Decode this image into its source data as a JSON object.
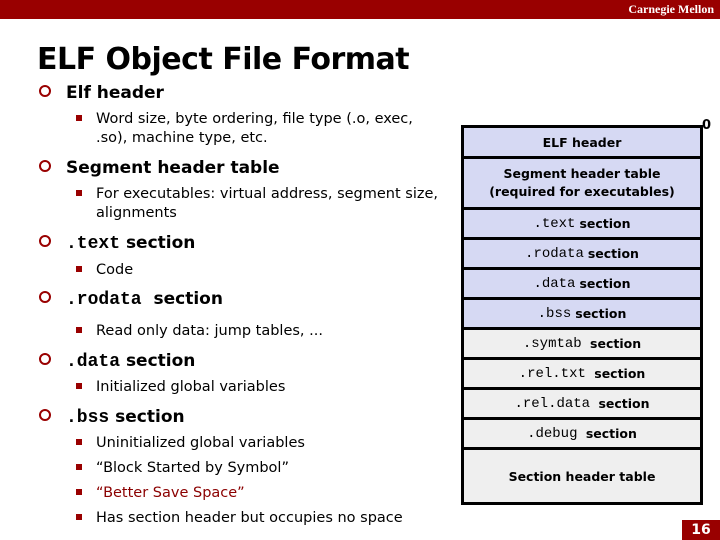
{
  "header": {
    "brand": "Carnegie Mellon"
  },
  "title": "ELF Object File Format",
  "bullets": [
    {
      "prefix_mono": "",
      "label": "Elf header",
      "subs": [
        {
          "text": "Word size, byte ordering, file type (.o, exec,",
          "text2": ".so), machine type, etc."
        }
      ]
    },
    {
      "prefix_mono": "",
      "label": "Segment header table",
      "subs": [
        {
          "text": "For executables: virtual address, segment size,",
          "text2": "alignments"
        }
      ]
    },
    {
      "prefix_mono": ".text",
      "label": "section",
      "subs": [
        {
          "text": "Code"
        }
      ]
    },
    {
      "prefix_mono": ".rodata",
      "label": "section",
      "subs": [
        {
          "text": "Read only data: jump tables, ..."
        }
      ]
    },
    {
      "prefix_mono": ".data",
      "label": "section",
      "subs": [
        {
          "text": "Initialized global variables"
        }
      ]
    },
    {
      "prefix_mono": ".bss",
      "label": "section",
      "subs": [
        {
          "text": "Uninitialized global variables"
        },
        {
          "text": "“Block Started by Symbol”"
        },
        {
          "text": "“Better Save Space”",
          "highlight": true
        },
        {
          "text": "Has section header but occupies no space"
        }
      ]
    }
  ],
  "diagram": {
    "offset_label": "0",
    "cells": [
      {
        "mono": "",
        "text": "ELF header",
        "text2": "",
        "kind": "blue"
      },
      {
        "mono": "",
        "text": "Segment header table",
        "text2": "(required for executables)",
        "kind": "blue"
      },
      {
        "mono": ".text",
        "text": "section",
        "text2": "",
        "kind": "blue"
      },
      {
        "mono": ".rodata",
        "text": "section",
        "text2": "",
        "kind": "blue"
      },
      {
        "mono": ".data",
        "text": "section",
        "text2": "",
        "kind": "blue"
      },
      {
        "mono": ".bss",
        "text": "section",
        "text2": "",
        "kind": "blue"
      },
      {
        "mono": ".symtab",
        "text": "section",
        "text2": "",
        "kind": "grey"
      },
      {
        "mono": ".rel.txt",
        "text": "section",
        "text2": "",
        "kind": "grey"
      },
      {
        "mono": ".rel.data",
        "text": "section",
        "text2": "",
        "kind": "grey"
      },
      {
        "mono": ".debug",
        "text": "section",
        "text2": "",
        "kind": "grey"
      },
      {
        "mono": "",
        "text": "Section header table",
        "text2": "",
        "kind": "grey"
      }
    ]
  },
  "page_number": "16",
  "colors": {
    "brand": "#990000",
    "box_blue": "#d6d9f3",
    "box_grey": "#efefef"
  }
}
